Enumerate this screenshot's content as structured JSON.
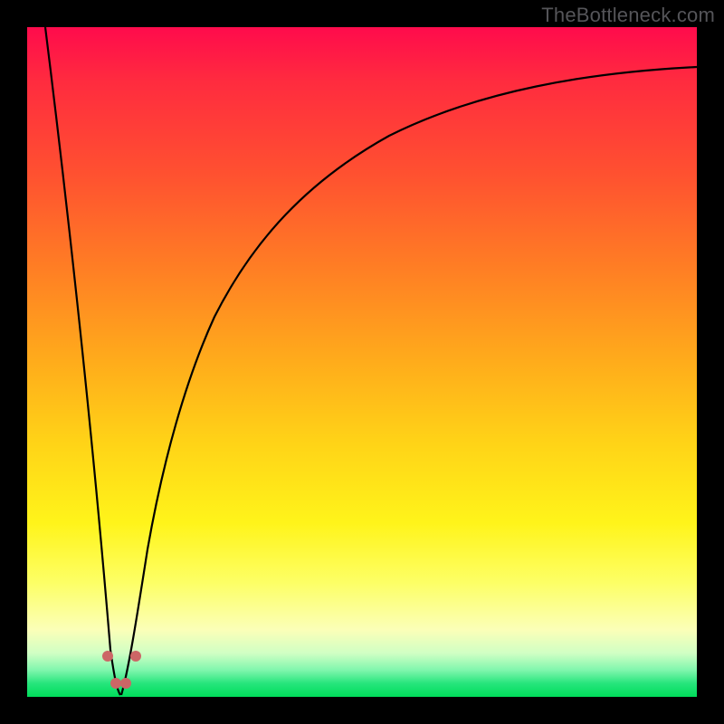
{
  "attribution_text": "TheBottleneck.com",
  "colors": {
    "frame": "#000000",
    "curve_stroke": "#000000",
    "marker_fill": "#cc6666",
    "gradient_stops": [
      "#ff0b4c",
      "#ff2b3f",
      "#ff5130",
      "#ff7e24",
      "#ffac1b",
      "#ffd317",
      "#fff41a",
      "#fdff66",
      "#fbffb8",
      "#d0ffc4",
      "#80f6ad",
      "#26e57c",
      "#00dd5a"
    ]
  },
  "chart_data": {
    "type": "line",
    "title": "",
    "xlabel": "",
    "ylabel": "",
    "x_range": [
      0,
      100
    ],
    "y_range": [
      0,
      100
    ],
    "description": "Heat-map gradient background (red=worst at top, green=best at bottom) with a V-shaped bottleneck curve. Minimum near x≈14 where y≈0.",
    "left_branch": {
      "x": [
        2.7,
        14
      ],
      "y": [
        100,
        0
      ],
      "shape": "near-vertical steep descent to minimum"
    },
    "right_branch_samples": {
      "x": [
        14,
        18,
        22,
        28,
        35,
        45,
        60,
        80,
        100
      ],
      "y": [
        0,
        22,
        38,
        53,
        65,
        75,
        84,
        90.5,
        94
      ]
    },
    "markers": [
      {
        "x": 12.0,
        "y": 6.0
      },
      {
        "x": 13.3,
        "y": 2.0
      },
      {
        "x": 14.7,
        "y": 2.0
      },
      {
        "x": 16.2,
        "y": 6.0
      }
    ]
  }
}
